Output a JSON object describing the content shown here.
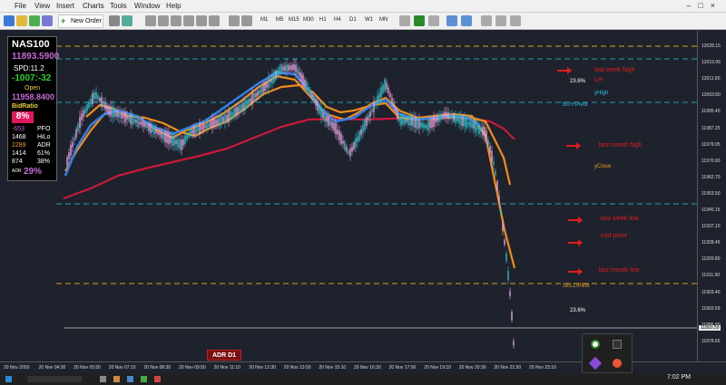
{
  "menu": {
    "items": [
      "File",
      "View",
      "Insert",
      "Charts",
      "Tools",
      "Window",
      "Help"
    ]
  },
  "toolbar": {
    "new_order": "New Order",
    "timeframes": [
      "M1",
      "M5",
      "M15",
      "M30",
      "H1",
      "H4",
      "D1",
      "W1",
      "MN"
    ]
  },
  "panel": {
    "symbol": "NAS100",
    "bid": "11893.5900",
    "spread": "SPD:11.2",
    "change": "-1007:-32",
    "open_label": "Open",
    "open_value": "11958.8400",
    "bid_ratio_label": "BidRatio",
    "bid_ratio_value": "8%",
    "pfo_value": "-653",
    "pfo_label": "PFO",
    "hilo_value": "1468",
    "hilo_label": "HiLo",
    "adr_value": "2289",
    "adr_label": "ADR",
    "r1a": "1414",
    "r1b": "61%",
    "r2a": "874",
    "r2b": "38%",
    "adr_pct_label": "ADR",
    "adr_pct": "29%"
  },
  "annotations": {
    "last_week_high": "last week high",
    "lh": "LH",
    "fib_top": "23.6%",
    "yhigh": "yHigh",
    "buy_pivot": "BUY/Pivot",
    "last_month_high": "last month high",
    "yclose": "yClose",
    "last_week_low": "last week low",
    "mid_point": "mid point",
    "last_month_low": "last month low",
    "sell_pivot": "SELL/Pivot",
    "fib_bottom": "23.6%",
    "adr_d1": "ADR D1"
  },
  "price_axis": {
    "labels": [
      "12028.15",
      "12019.95",
      "12011.80",
      "12003.60",
      "11995.40",
      "11987.25",
      "11979.05",
      "11970.90",
      "11962.70",
      "11953.50",
      "11945.15",
      "11937.10",
      "11928.45",
      "11920.80",
      "11911.90",
      "11903.40",
      "11893.59",
      "11886.90",
      "11878.65"
    ],
    "current_price": "11893.59"
  },
  "time_axis": {
    "labels": [
      "20 Nov 2020",
      "20 Nov 04:30",
      "20 Nov 05:50",
      "20 Nov 07:10",
      "20 Nov 08:30",
      "20 Nov 09:50",
      "20 Nov 11:10",
      "20 Nov 12:30",
      "20 Nov 13:50",
      "20 Nov 15:10",
      "20 Nov 16:30",
      "20 Nov 17:50",
      "20 Nov 19:10",
      "20 Nov 20:30",
      "20 Nov 21:50",
      "20 Nov 23:10"
    ]
  },
  "taskbar": {
    "clock": "7:02 PM"
  },
  "colors": {
    "background": "#1e222d",
    "up_candle": "#2ec4c8",
    "down_candle": "#e8a0e0",
    "ma_fast": "#2f80ed",
    "ma_mid": "#f28c1a",
    "ma_slow": "#c8193a",
    "level_yellow": "#d8a017",
    "level_cyan": "#1aa7b5",
    "annotation_red": "#e21c1c"
  }
}
